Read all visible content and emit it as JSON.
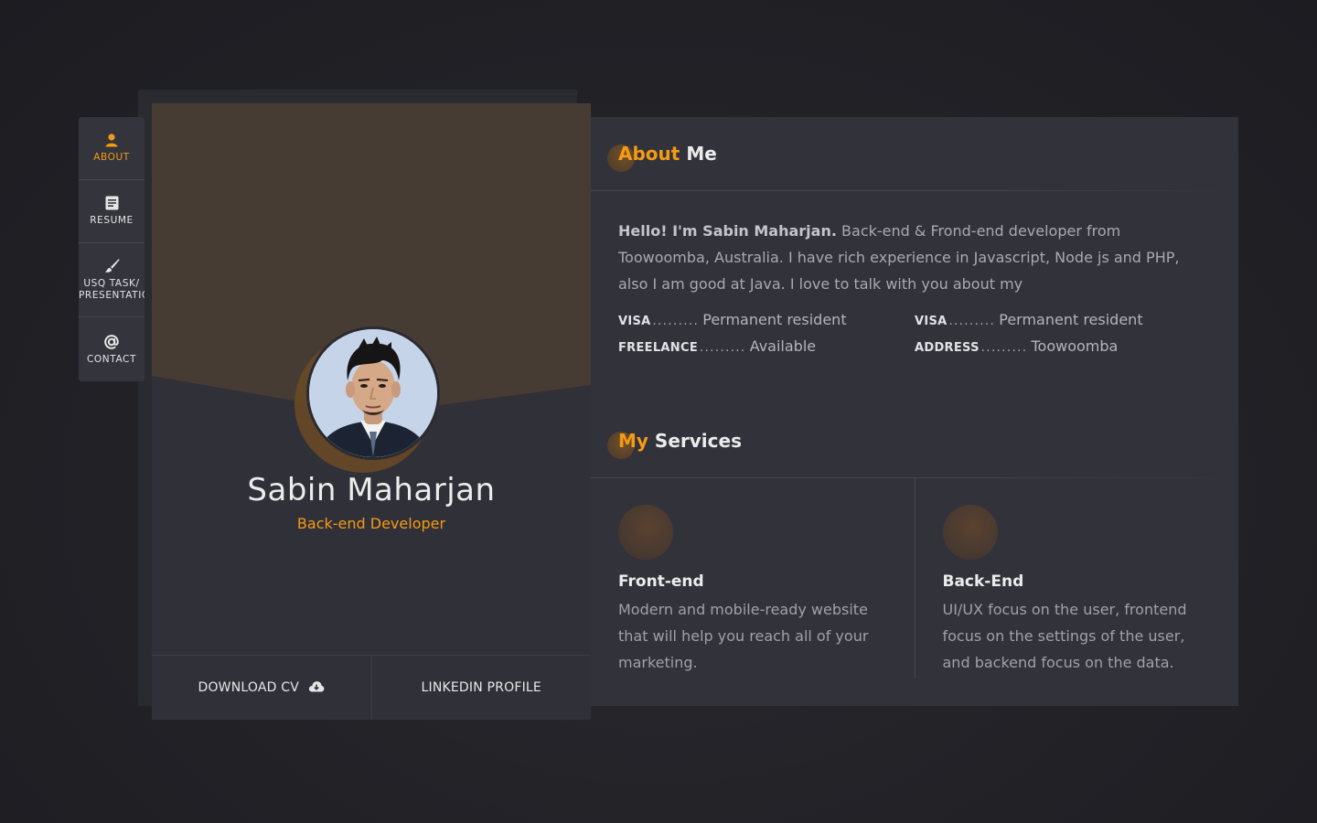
{
  "nav": {
    "items": [
      {
        "label": "ABOUT",
        "icon": "user-icon",
        "active": true
      },
      {
        "label": "RESUME",
        "icon": "document-icon",
        "active": false
      },
      {
        "label": "USQ TASK/ PRESENTATIC",
        "icon": "brush-icon",
        "active": false
      },
      {
        "label": "CONTACT",
        "icon": "at-icon",
        "active": false
      }
    ]
  },
  "profile": {
    "name": "Sabin Maharjan",
    "role": "Back-end Developer",
    "download_label": "DOWNLOAD CV",
    "download_icon": "cloud-download-icon",
    "linkedin_label": "LINKEDIN PROFILE"
  },
  "about": {
    "title_accent": "About",
    "title_rest": "Me",
    "intro_bold": "Hello! I'm Sabin Maharjan.",
    "intro_text": "Back-end & Frond-end developer from Toowoomba, Australia. I have rich experience in Javascript, Node js and PHP, also I am good at Java. I love to talk with you about my",
    "info": [
      {
        "key": "VISA",
        "dots": ".........",
        "value": "Permanent resident"
      },
      {
        "key": "VISA",
        "dots": ".........",
        "value": "Permanent resident"
      },
      {
        "key": "FREELANCE",
        "dots": ".........",
        "value": "Available"
      },
      {
        "key": "ADDRESS",
        "dots": ".........",
        "value": "Toowoomba"
      }
    ]
  },
  "services": {
    "title_accent": "My",
    "title_rest": "Services",
    "items": [
      {
        "title": "Front-end",
        "desc": "Modern and mobile-ready website that will help you reach all of your marketing."
      },
      {
        "title": "Back-End",
        "desc": "UI/UX focus on the user, frontend focus on the settings of the user, and backend focus on the data."
      }
    ]
  },
  "colors": {
    "accent": "#f59a14",
    "panel": "#32323a",
    "header_bg": "#473c33"
  }
}
